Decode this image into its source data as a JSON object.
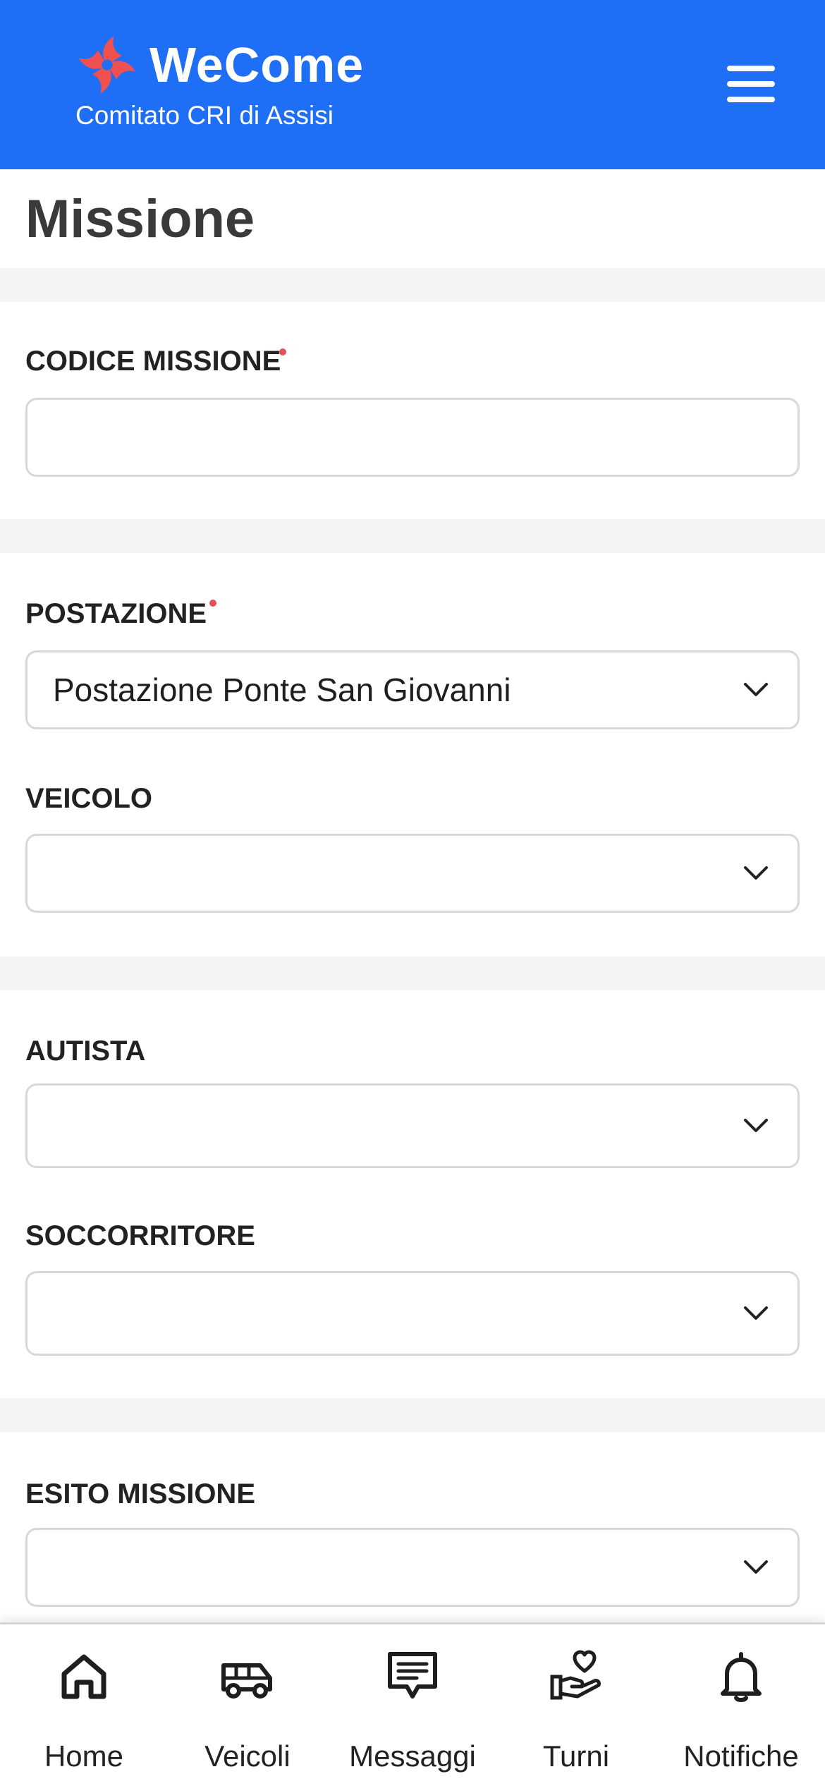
{
  "header": {
    "brand": "WeCome",
    "subtitle": "Comitato CRI di Assisi",
    "logo_icon": "pinwheel-logo-icon",
    "menu_icon": "hamburger-menu-icon",
    "background": "#1e6ef6",
    "logo_color": "#f05050"
  },
  "page": {
    "title": "Missione"
  },
  "form": {
    "codice_missione": {
      "label": "CODICE MISSIONE",
      "value": "",
      "required": true
    },
    "postazione": {
      "label": "POSTAZIONE",
      "value": "Postazione Ponte San Giovanni",
      "required": true
    },
    "veicolo": {
      "label": "VEICOLO",
      "value": ""
    },
    "autista": {
      "label": "AUTISTA",
      "value": ""
    },
    "soccorritore": {
      "label": "SOCCORRITORE",
      "value": ""
    },
    "esito_missione": {
      "label": "ESITO MISSIONE",
      "value": ""
    }
  },
  "bottom_nav": [
    {
      "label": "Home",
      "icon": "home-icon"
    },
    {
      "label": "Veicoli",
      "icon": "van-icon"
    },
    {
      "label": "Messaggi",
      "icon": "message-icon"
    },
    {
      "label": "Turni",
      "icon": "heart-hand-icon"
    },
    {
      "label": "Notifiche",
      "icon": "bell-icon"
    }
  ],
  "colors": {
    "required_dot": "#e5505a",
    "divider": "#f4f4f4",
    "border": "#d8d8d8"
  }
}
